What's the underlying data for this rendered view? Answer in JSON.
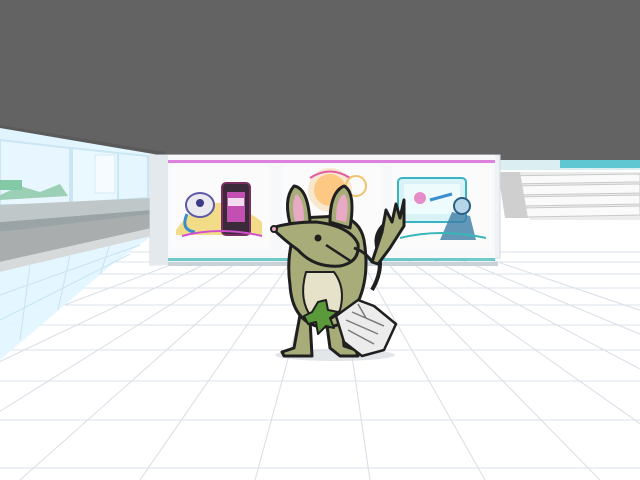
{
  "scene": {
    "colors": {
      "ceiling": "#636363",
      "floor": "#ffffff",
      "floor_grid": "#d9dde4",
      "wall_tint": "#cfefff",
      "pool": "#e9f8ff",
      "kiosk": "#eef3f6",
      "trim_pink": "#d24fd0",
      "trim_teal": "#38b7b7",
      "creature_body": "#a7ac78",
      "creature_belly": "#e6e1c9",
      "creature_ear": "#e7a9c4",
      "creature_outline": "#1f1f1f",
      "leaf": "#5a9a3b",
      "paper": "#ececec"
    },
    "kiosk_posters": [
      {
        "name": "poster-phone-creature",
        "description_icon": "creature-with-phone"
      },
      {
        "name": "poster-pizza-creature",
        "description_icon": "creature-with-pizza"
      },
      {
        "name": "poster-laptop-robot",
        "description_icon": "robot-at-screen"
      }
    ],
    "character": {
      "name_icon": "mouse-creature",
      "holding": [
        "leaf",
        "crumpled-paper"
      ]
    }
  }
}
